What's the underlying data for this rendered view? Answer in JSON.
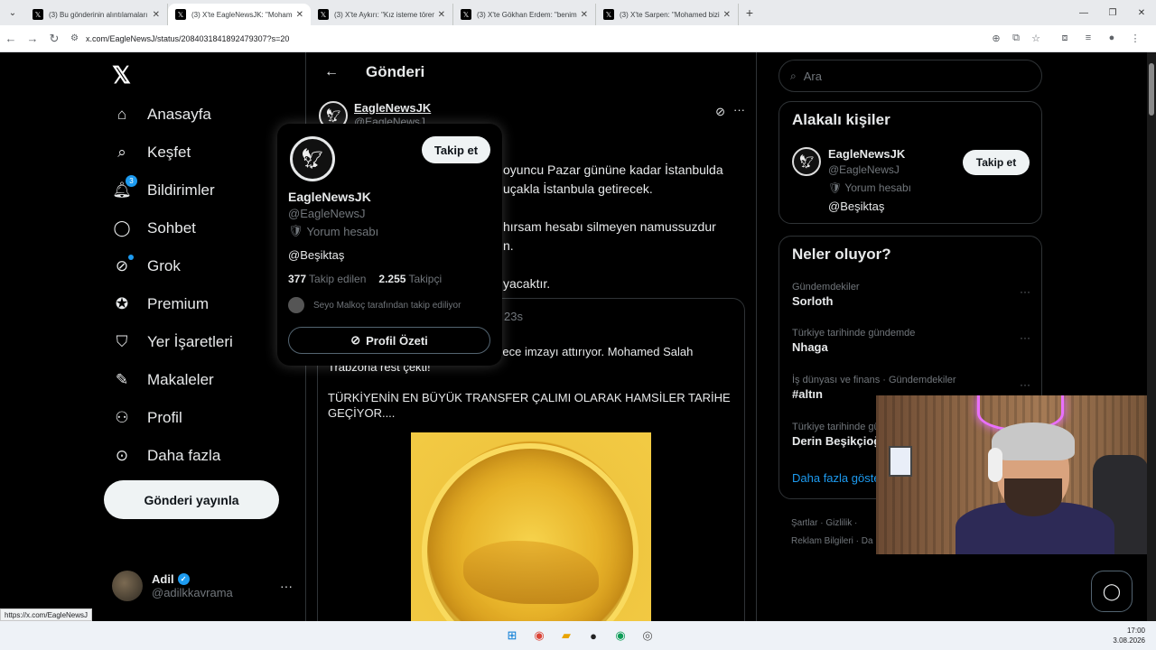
{
  "browser": {
    "tabs": [
      {
        "title": "(3) Bu gönderinin alıntılamaları",
        "active": false
      },
      {
        "title": "(3) X'te EagleNewsJK: \"Mohame",
        "active": true
      },
      {
        "title": "(3) X'te Aykırı: \"Kız isteme tören",
        "active": false
      },
      {
        "title": "(3) X'te Gökhan Erdem: \"benim",
        "active": false
      },
      {
        "title": "(3) X'te Sarpen: \"Mohamed bizi",
        "active": false
      }
    ],
    "url": "x.com/EagleNewsJ/status/2084031841892479307?s=20",
    "status_url": "https://x.com/EagleNewsJ"
  },
  "nav": {
    "items": [
      {
        "label": "Anasayfa",
        "icon": "home-icon"
      },
      {
        "label": "Keşfet",
        "icon": "search-icon"
      },
      {
        "label": "Bildirimler",
        "icon": "bell-icon",
        "badge": "3"
      },
      {
        "label": "Sohbet",
        "icon": "chat-icon"
      },
      {
        "label": "Grok",
        "icon": "grok-icon"
      },
      {
        "label": "Premium",
        "icon": "premium-icon"
      },
      {
        "label": "Yer İşaretleri",
        "icon": "bookmark-icon"
      },
      {
        "label": "Makaleler",
        "icon": "article-icon"
      },
      {
        "label": "Profil",
        "icon": "profile-icon"
      },
      {
        "label": "Daha fazla",
        "icon": "more-circle-icon"
      }
    ],
    "post_button": "Gönderi yayınla",
    "account": {
      "name": "Adil",
      "handle": "@adilkkavrama"
    }
  },
  "main": {
    "title": "Gönderi",
    "author": {
      "name": "EagleNewsJK",
      "handle": "@EagleNewsJ"
    },
    "tweet_lines": [
      "oyuncu Pazar gününe kadar İstanbulda",
      "uçakla İstanbula getirecek.",
      "",
      "hırsam hesabı silmeyen namussuzdur",
      "n.",
      "",
      "yacaktır."
    ],
    "quote": {
      "time": "23s",
      "line1": "ha bu gece imzayı attırıyor. Mohamed Salah",
      "line2": "Trabzona rest çekti!",
      "line3": "TÜRKİYENİN EN BÜYÜK TRANSFER ÇALIMI OLARAK HAMSİLER TARİHE GEÇİYOR...."
    }
  },
  "hovercard": {
    "name": "EagleNewsJK",
    "handle": "@EagleNewsJ",
    "label": "Yorum hesabı",
    "bio": "@Beşiktaş",
    "following_count": "377",
    "following_label": "Takip edilen",
    "followers_count": "2.255",
    "followers_label": "Takipçi",
    "followed_by": "Seyo Malkoç tarafından takip ediliyor",
    "follow_button": "Takip et",
    "summary_button": "Profil Özeti"
  },
  "right": {
    "search_placeholder": "Ara",
    "related": {
      "title": "Alakalı kişiler",
      "name": "EagleNewsJK",
      "handle": "@EagleNewsJ",
      "label": "Yorum hesabı",
      "bio": "@Beşiktaş",
      "follow_button": "Takip et"
    },
    "trends": {
      "title": "Neler oluyor?",
      "items": [
        {
          "category": "Gündemdekiler",
          "name": "Sorloth"
        },
        {
          "category": "Türkiye tarihinde gündemde",
          "name": "Nhaga"
        },
        {
          "category": "İş dünyası ve finans · Gündemdekiler",
          "name": "#altın"
        },
        {
          "category": "Türkiye tarihinde gü",
          "name": "Derin Beşikçioğ"
        }
      ],
      "show_more": "Daha fazla göste"
    },
    "footer_line1": "Şartlar  ·  Gizlilik  ·",
    "footer_line2": "Reklam Bilgileri  ·  Da"
  },
  "taskbar": {
    "time": "17:00",
    "date": "3.08.2026"
  }
}
